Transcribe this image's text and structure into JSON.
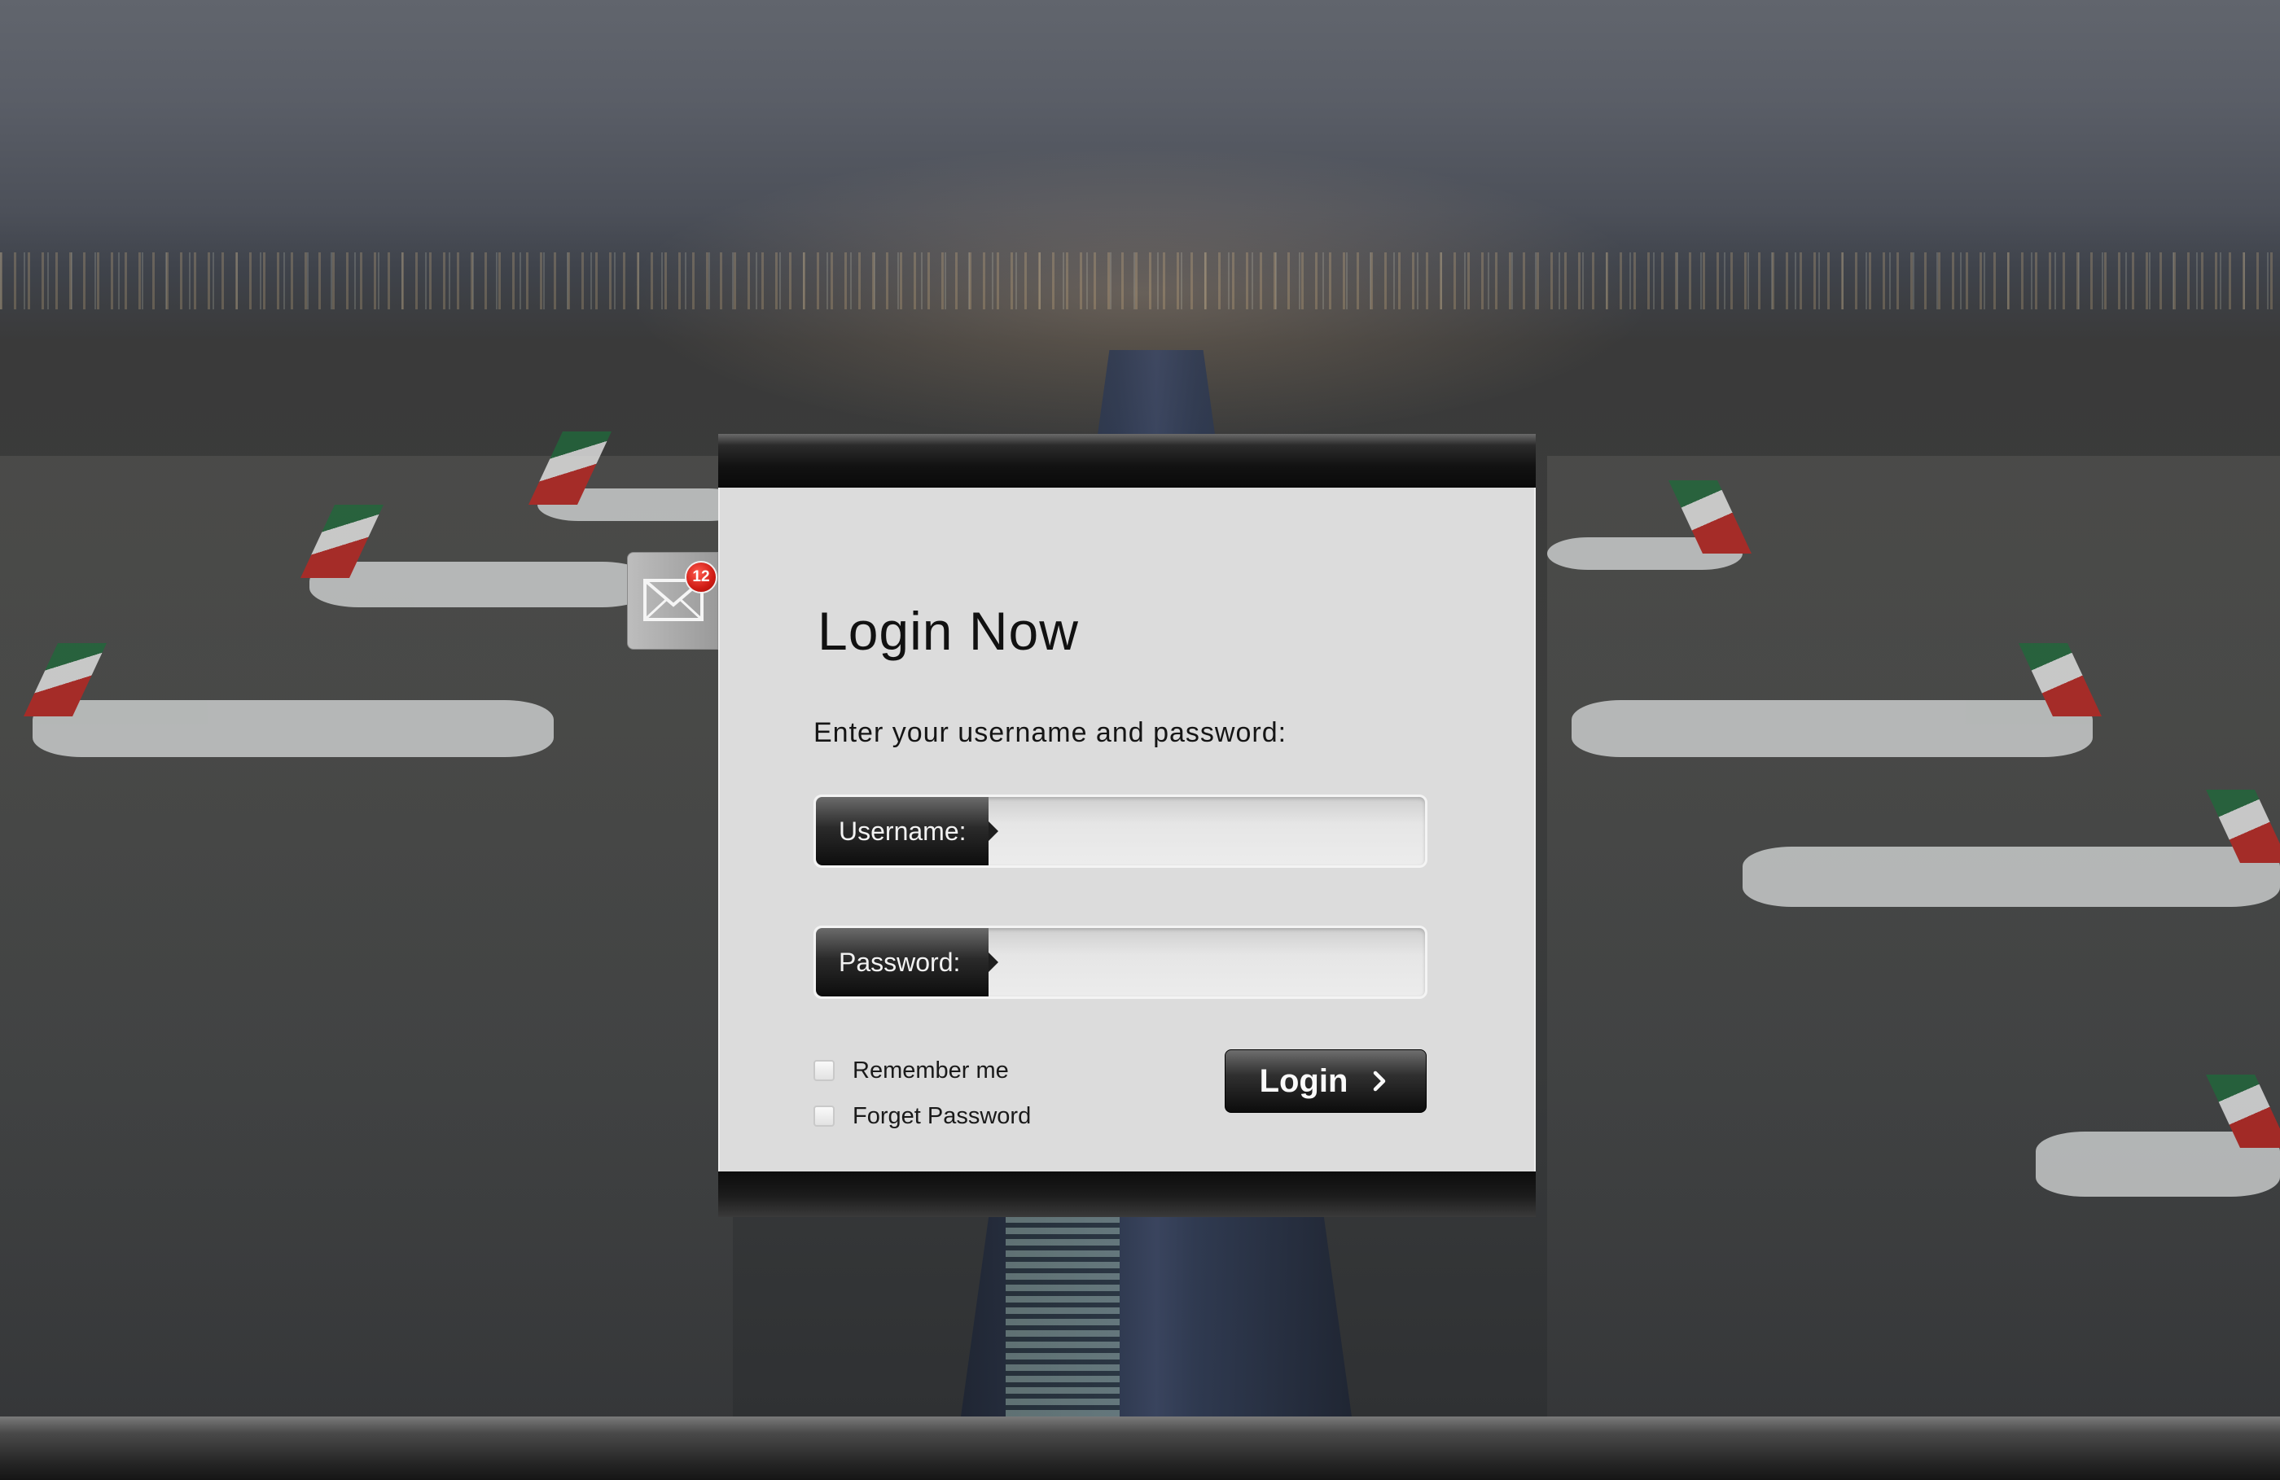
{
  "login": {
    "title": "Login Now",
    "subtitle": "Enter your username and password:",
    "username_label": "Username:",
    "username_value": "",
    "password_label": "Password:",
    "password_value": "",
    "remember_label": "Remember me",
    "remember_checked": false,
    "forget_label": "Forget Password",
    "forget_checked": false,
    "submit_label": "Login",
    "submit_icon": "chevron-right-icon"
  },
  "notifications": {
    "icon": "envelope-icon",
    "count": "12",
    "badge_color": "#d9221a"
  },
  "colors": {
    "panel": "#dcdcdc",
    "button": "#1a1a1a",
    "label_pill": "#222222"
  }
}
